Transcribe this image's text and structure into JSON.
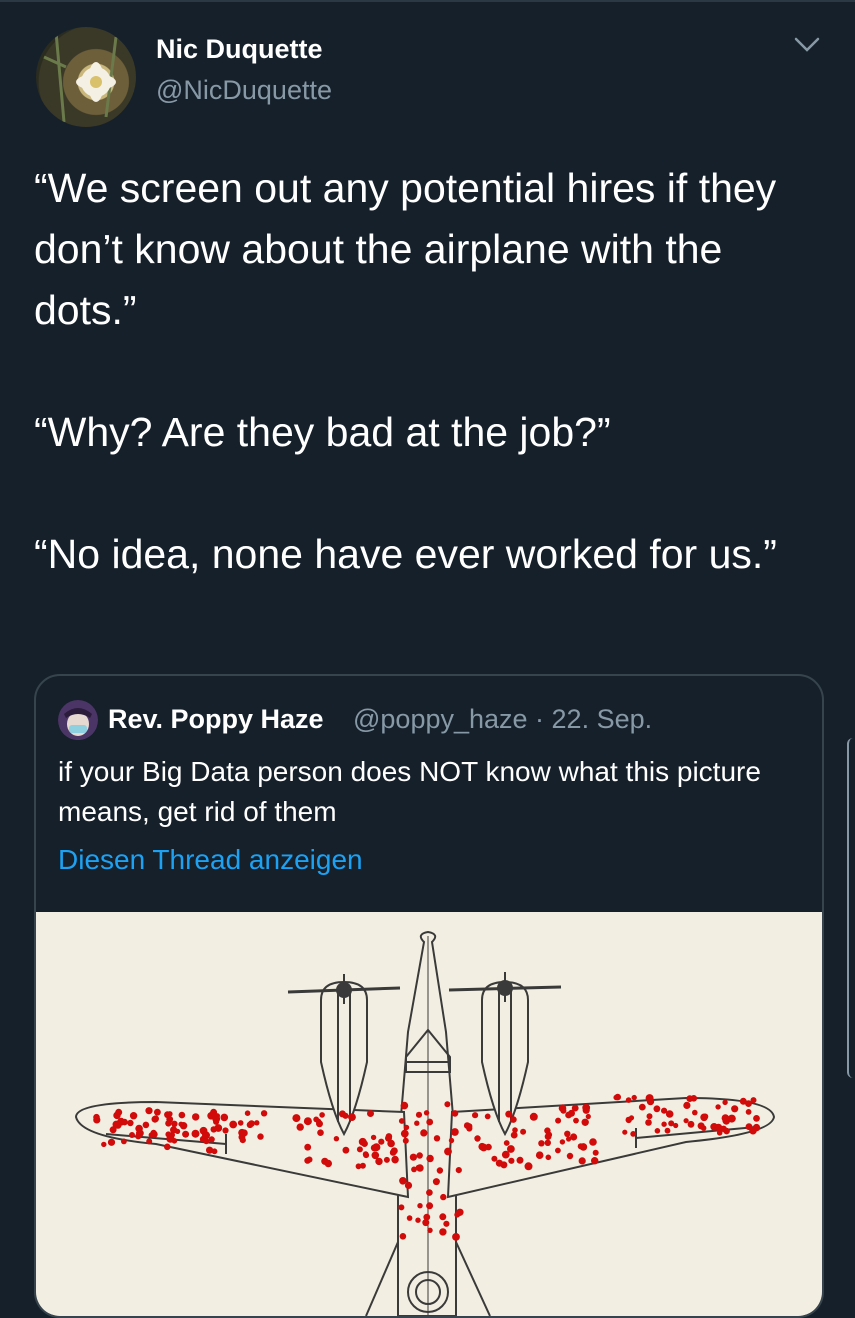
{
  "author": {
    "display_name": "Nic Duquette",
    "handle": "@NicDuquette"
  },
  "tweet": {
    "paragraphs": [
      "“We screen out any potential hires if they don’t know about the airplane with the dots.”",
      "“Why? Are they bad at the job?”",
      "“No idea, none have ever worked for us.”"
    ]
  },
  "quoted_tweet": {
    "display_name": "Rev. Poppy Haze",
    "meta": "@poppy_haze · 22. Sep.",
    "text": "if your Big Data person does NOT know what this picture means, get rid of them",
    "show_thread": "Diesen Thread anzeigen"
  },
  "icons": {
    "menu": "chevron-down-icon",
    "image": "airplane-with-bullet-holes"
  },
  "colors": {
    "background": "#15202b",
    "secondary_text": "#8899a6",
    "link": "#1da1f2",
    "border": "#38444d",
    "dots": "#d10a0a"
  }
}
